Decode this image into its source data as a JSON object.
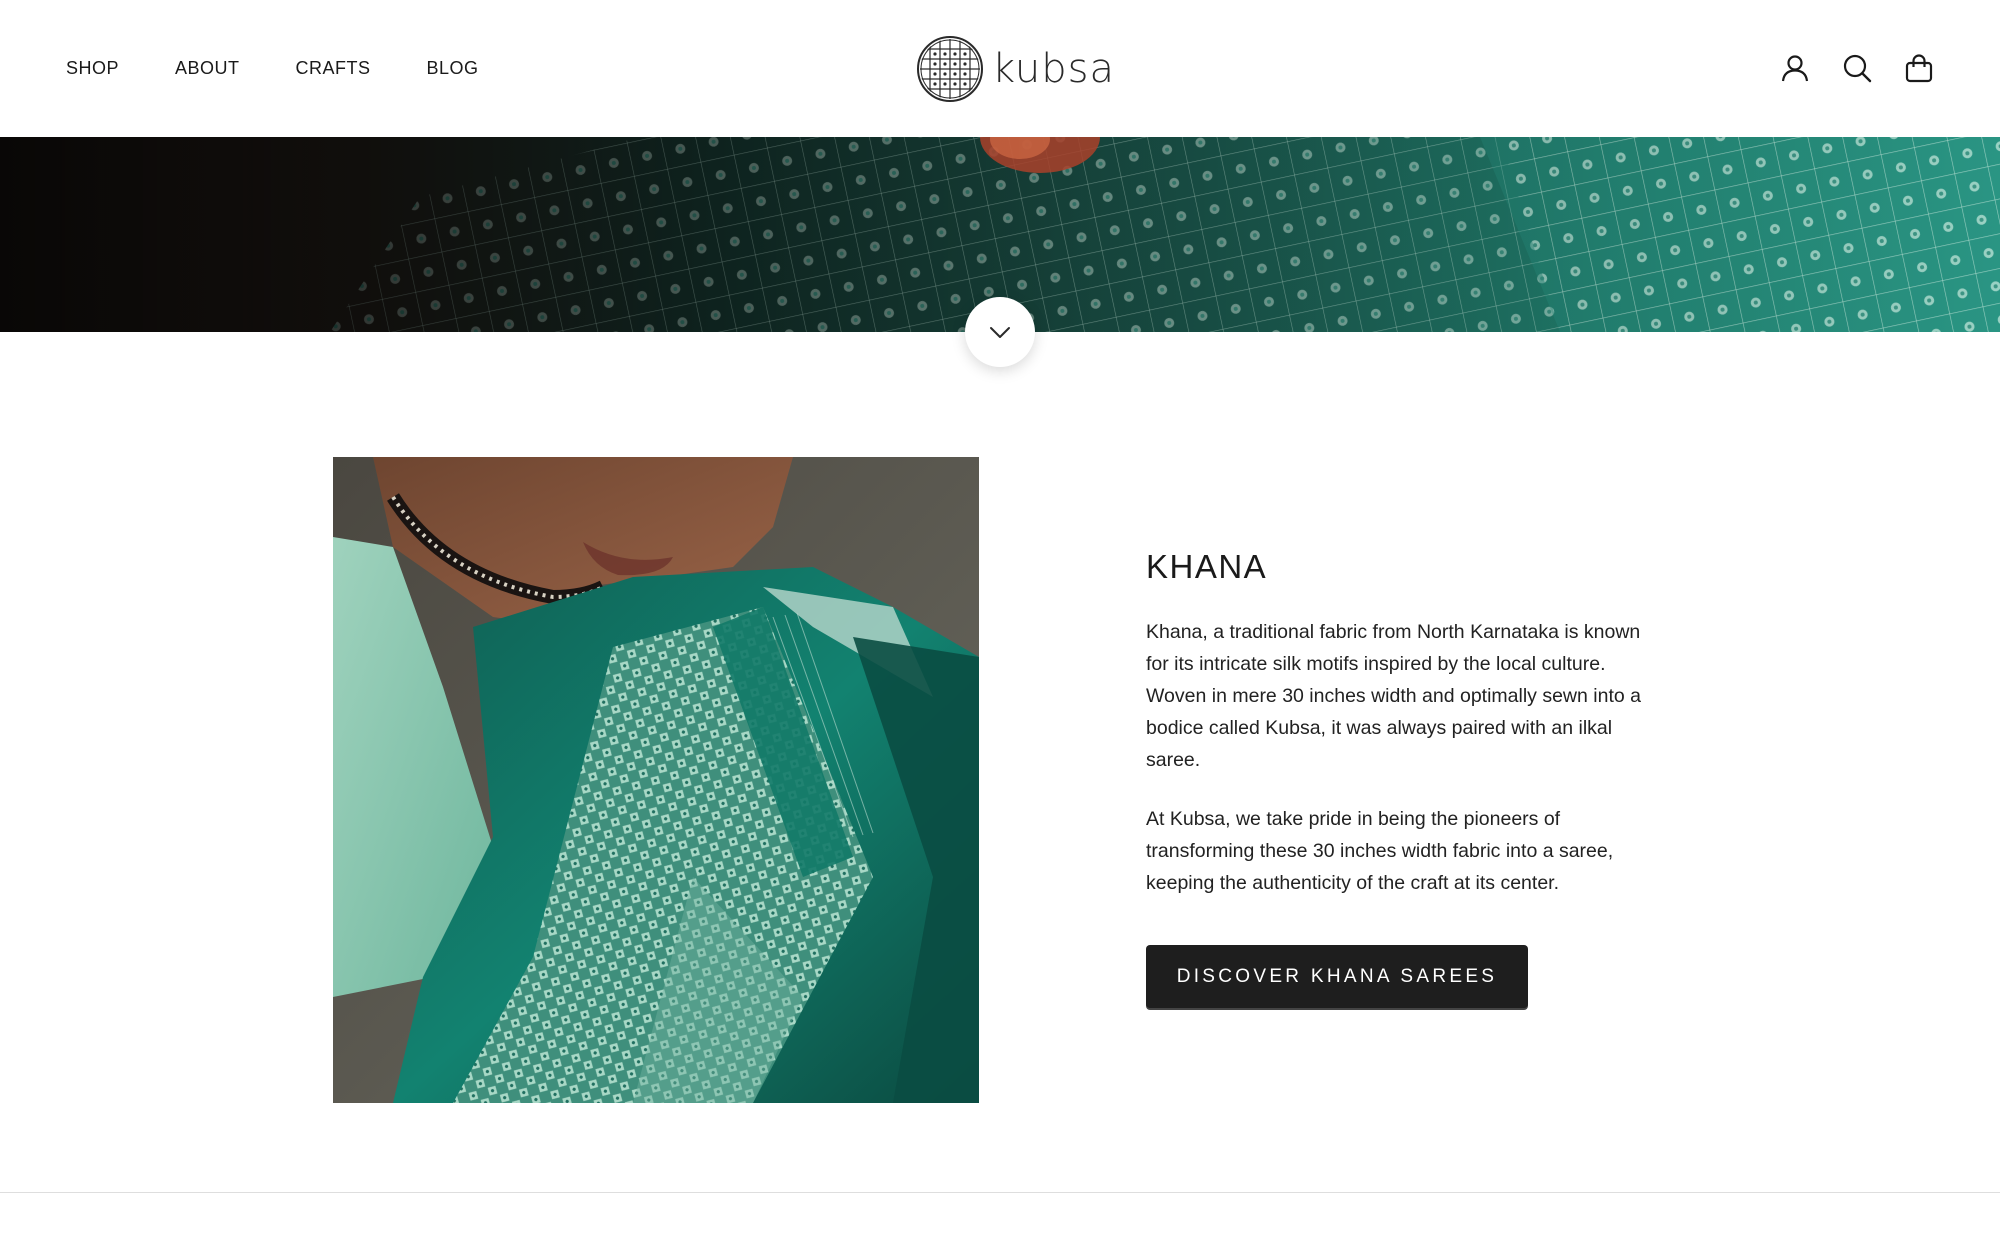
{
  "header": {
    "nav": [
      "SHOP",
      "ABOUT",
      "CRAFTS",
      "BLOG"
    ],
    "logo_text": "kubsa",
    "icons": [
      "account-icon",
      "search-icon",
      "bag-icon"
    ]
  },
  "hero": {
    "scroll_icon": "chevron-down-icon"
  },
  "feature": {
    "title": "KHANA",
    "paragraph_1": "Khana, a traditional fabric from North Karnataka is known for its intricate silk motifs inspired by the local culture. Woven in mere 30 inches width and optimally sewn into a bodice called Kubsa, it was always paired with an ilkal saree.",
    "paragraph_2": "At Kubsa, we take pride in being the pioneers of transforming these 30 inches width fabric into a saree, keeping the authenticity of the craft at its center.",
    "cta_label": "DISCOVER KHANA SAREES"
  },
  "colors": {
    "accent_teal": "#1f8f7c",
    "button_dark": "#1e1e1e"
  }
}
